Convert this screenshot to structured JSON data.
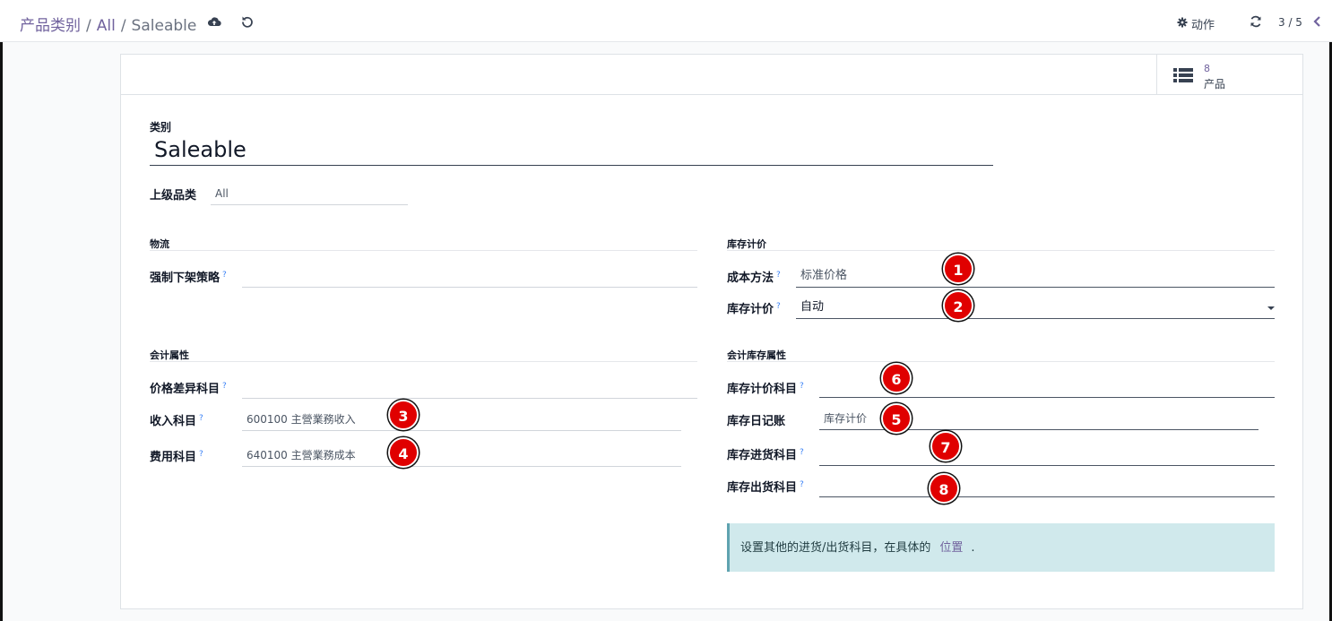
{
  "breadcrumb": {
    "root": "产品类别",
    "sep1": "/",
    "parent": "All",
    "sep2": "/",
    "current": "Saleable"
  },
  "toolbar": {
    "save_icon": "cloud-upload-icon",
    "discard_icon": "undo-icon",
    "actions_label": "动作",
    "actions_icon": "gear-icon",
    "refresh_icon": "refresh-icon",
    "pager": "3 / 5",
    "prev_icon": "chevron-left-icon"
  },
  "smart_button": {
    "icon": "list-icon",
    "count": "8",
    "label": "产品"
  },
  "form": {
    "name_label": "类别",
    "name_value": "Saleable",
    "parent_label": "上级品类",
    "parent_value": "All"
  },
  "logistics": {
    "title": "物流",
    "removal_label": "强制下架策略",
    "removal_value": ""
  },
  "inventory_valuation": {
    "title": "库存计价",
    "cost_method_label": "成本方法",
    "cost_method_value": "标准价格",
    "valuation_label": "库存计价",
    "valuation_value": "自动"
  },
  "account_properties": {
    "title": "会计属性",
    "price_diff_label": "价格差异科目",
    "price_diff_value": "",
    "income_label": "收入科目",
    "income_value": "600100 主營業務收入",
    "expense_label": "费用科目",
    "expense_value": "640100 主營業務成本"
  },
  "stock_account_properties": {
    "title": "会计库存属性",
    "valuation_account_label": "库存计价科目",
    "valuation_account_value": "",
    "journal_label": "库存日记账",
    "journal_value": "库存计价",
    "input_account_label": "库存进货科目",
    "input_account_value": "",
    "output_account_label": "库存出货科目",
    "output_account_value": ""
  },
  "help_mark": "?",
  "alert": {
    "text": "设置其他的进货/出货科目，在具体的",
    "link": "位置",
    "suffix": "."
  },
  "badges": [
    "1",
    "2",
    "3",
    "4",
    "6",
    "5",
    "7",
    "8"
  ],
  "colors": {
    "accent": "#71639e",
    "badge": "#e00000",
    "alert_bg": "#d0e9ec"
  }
}
